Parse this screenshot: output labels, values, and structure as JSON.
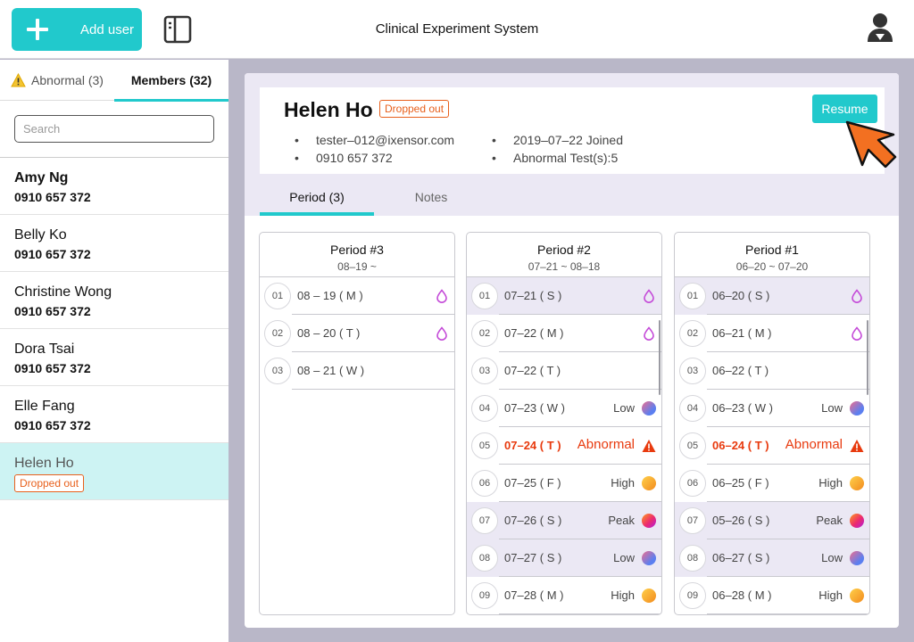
{
  "header": {
    "add_user_label": "Add user",
    "title": "Clinical Experiment System",
    "icons": [
      "plus-icon",
      "panel-toggle-icon",
      "user-avatar-icon"
    ],
    "accent_color": "#21c9cc"
  },
  "sidebar": {
    "tabs": [
      {
        "label": "Abnormal (3)",
        "icon": "warning-icon"
      },
      {
        "label": "Members (32)"
      }
    ],
    "search_placeholder": "Search",
    "members": [
      {
        "name": "Amy Ng",
        "phone": "0910 657 372"
      },
      {
        "name": "Belly Ko",
        "phone": "0910 657 372"
      },
      {
        "name": "Christine Wong",
        "phone": "0910 657 372"
      },
      {
        "name": "Dora Tsai",
        "phone": "0910 657 372"
      },
      {
        "name": "Elle Fang",
        "phone": "0910 657 372"
      },
      {
        "name": "Helen Ho",
        "badge": "Dropped out"
      }
    ]
  },
  "profile": {
    "name": "Helen Ho",
    "badge": "Dropped out",
    "resume_label": "Resume",
    "email": "tester–012@ixensor.com",
    "phone": "0910 657 372",
    "joined": "2019–07–22 Joined",
    "abnormal_tests": "Abnormal Test(s):5"
  },
  "content_tabs": [
    {
      "label": "Period (3)"
    },
    {
      "label": "Notes"
    }
  ],
  "periods": [
    {
      "title": "Period #3",
      "range": "08–19 ~",
      "rows": [
        {
          "num": "01",
          "date": "08 – 19 ( M )",
          "status": "",
          "icon": "drop-icon"
        },
        {
          "num": "02",
          "date": "08 – 20 ( T )",
          "status": "",
          "icon": "drop-icon"
        },
        {
          "num": "03",
          "date": "08 – 21 ( W )",
          "status": "",
          "icon": ""
        }
      ]
    },
    {
      "title": "Period #2",
      "range": "07–21 ~ 08–18",
      "rows": [
        {
          "num": "01",
          "date": "07–21 ( S )",
          "status": "",
          "icon": "drop-icon",
          "shaded": true
        },
        {
          "num": "02",
          "date": "07–22 ( M )",
          "status": "",
          "icon": "drop-icon"
        },
        {
          "num": "03",
          "date": "07–22 ( T )",
          "status": "",
          "icon": ""
        },
        {
          "num": "04",
          "date": "07–23 ( W )",
          "status": "Low",
          "icon": "low-dot-icon"
        },
        {
          "num": "05",
          "date": "07–24 ( T )",
          "status": "Abnormal",
          "icon": "warning-icon",
          "abnormal": true
        },
        {
          "num": "06",
          "date": "07–25 ( F )",
          "status": "High",
          "icon": "high-dot-icon"
        },
        {
          "num": "07",
          "date": "07–26 ( S )",
          "status": "Peak",
          "icon": "peak-dot-icon",
          "shaded": true
        },
        {
          "num": "08",
          "date": "07–27 ( S )",
          "status": "Low",
          "icon": "low-dot-icon",
          "shaded": true
        },
        {
          "num": "09",
          "date": "07–28 ( M )",
          "status": "High",
          "icon": "high-dot-icon"
        }
      ]
    },
    {
      "title": "Period #1",
      "range": "06–20 ~ 07–20",
      "rows": [
        {
          "num": "01",
          "date": "06–20 ( S )",
          "status": "",
          "icon": "drop-icon",
          "shaded": true
        },
        {
          "num": "02",
          "date": "06–21 ( M )",
          "status": "",
          "icon": "drop-icon"
        },
        {
          "num": "03",
          "date": "06–22 ( T )",
          "status": "",
          "icon": ""
        },
        {
          "num": "04",
          "date": "06–23 ( W )",
          "status": "Low",
          "icon": "low-dot-icon"
        },
        {
          "num": "05",
          "date": "06–24 ( T )",
          "status": "Abnormal",
          "icon": "warning-icon",
          "abnormal": true
        },
        {
          "num": "06",
          "date": "06–25 ( F )",
          "status": "High",
          "icon": "high-dot-icon"
        },
        {
          "num": "07",
          "date": "05–26 ( S )",
          "status": "Peak",
          "icon": "peak-dot-icon",
          "shaded": true
        },
        {
          "num": "08",
          "date": "06–27 ( S )",
          "status": "Low",
          "icon": "low-dot-icon",
          "shaded": true
        },
        {
          "num": "09",
          "date": "06–28 ( M )",
          "status": "High",
          "icon": "high-dot-icon"
        }
      ]
    }
  ],
  "colors": {
    "accent": "#21c9cc",
    "abnormal": "#e83a0e",
    "badge": "#e8601c",
    "drop": "#c44ad8",
    "shaded_row": "#ebe8f4"
  }
}
